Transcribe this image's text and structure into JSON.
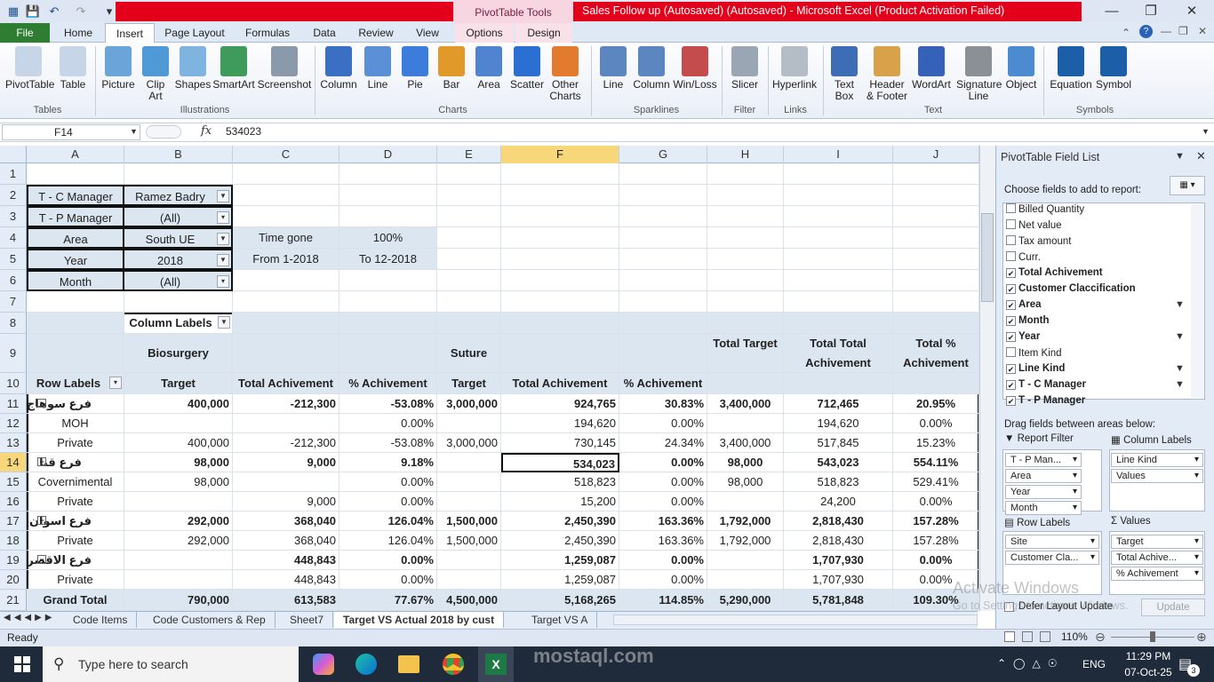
{
  "window": {
    "title": "Sales Follow up (Autosaved) (Autosaved)  -  Microsoft Excel (Product Activation Failed)",
    "context_tab": "PivotTable Tools"
  },
  "tabs": [
    "File",
    "Home",
    "Insert",
    "Page Layout",
    "Formulas",
    "Data",
    "Review",
    "View",
    "Options",
    "Design"
  ],
  "ribbon": {
    "groups": [
      "Tables",
      "Illustrations",
      "Charts",
      "Sparklines",
      "Filter",
      "Links",
      "Text",
      "Symbols"
    ],
    "buttons": [
      {
        "label": "PivotTable",
        "l2": "",
        "color": "#c7d5e8"
      },
      {
        "label": "Table",
        "l2": "",
        "color": "#c7d5e8"
      },
      {
        "label": "Picture",
        "l2": "",
        "color": "#6aa4d8"
      },
      {
        "label": "Clip",
        "l2": "Art",
        "color": "#4f9ad6"
      },
      {
        "label": "Shapes",
        "l2": "",
        "color": "#7fb3e0"
      },
      {
        "label": "SmartArt",
        "l2": "",
        "color": "#3e9b5b"
      },
      {
        "label": "Screenshot",
        "l2": "",
        "color": "#8a9aab"
      },
      {
        "label": "Column",
        "l2": "",
        "color": "#3b6fc4"
      },
      {
        "label": "Line",
        "l2": "",
        "color": "#5b8fd6"
      },
      {
        "label": "Pie",
        "l2": "",
        "color": "#3c7ddc"
      },
      {
        "label": "Bar",
        "l2": "",
        "color": "#e19a2a"
      },
      {
        "label": "Area",
        "l2": "",
        "color": "#5084d1"
      },
      {
        "label": "Scatter",
        "l2": "",
        "color": "#2a6fd1"
      },
      {
        "label": "Other",
        "l2": "Charts",
        "color": "#e37b2f"
      },
      {
        "label": "Line",
        "l2": "",
        "color": "#5b86bf"
      },
      {
        "label": "Column",
        "l2": "",
        "color": "#5b86bf"
      },
      {
        "label": "Win/Loss",
        "l2": "",
        "color": "#c44c4c"
      },
      {
        "label": "Slicer",
        "l2": "",
        "color": "#9aa6b4"
      },
      {
        "label": "Hyperlink",
        "l2": "",
        "color": "#b4bcc6"
      },
      {
        "label": "Text",
        "l2": "Box",
        "color": "#3d6db5"
      },
      {
        "label": "Header",
        "l2": "& Footer",
        "color": "#d8a24a"
      },
      {
        "label": "WordArt",
        "l2": "",
        "color": "#3561b8"
      },
      {
        "label": "Signature",
        "l2": "Line",
        "color": "#8b8f96"
      },
      {
        "label": "Object",
        "l2": "",
        "color": "#4c8bd0"
      },
      {
        "label": "Equation",
        "l2": "",
        "color": "#1d5ea8"
      },
      {
        "label": "Symbol",
        "l2": "",
        "color": "#1d5ea8"
      }
    ]
  },
  "formula": {
    "namebox": "F14",
    "fx": "fx",
    "value": "534023"
  },
  "columns": [
    "A",
    "B",
    "C",
    "D",
    "E",
    "F",
    "G",
    "H",
    "I",
    "J"
  ],
  "rows": [
    "1",
    "2",
    "3",
    "4",
    "5",
    "6",
    "7",
    "8",
    "9",
    "10",
    "11",
    "12",
    "13",
    "14",
    "15",
    "16",
    "17",
    "18",
    "19",
    "20",
    "21"
  ],
  "sheet": {
    "filters": [
      {
        "label": "T - C  Manager",
        "value": "Ramez Badry"
      },
      {
        "label": "T - P Manager",
        "value": "(All)"
      },
      {
        "label": "Area",
        "value": "South UE"
      },
      {
        "label": "Year",
        "value": "2018"
      },
      {
        "label": "Month",
        "value": "(All)"
      }
    ],
    "time": {
      "label": "Time gone",
      "value": "100%",
      "from": "From 1-2018",
      "to": "To 12-2018"
    },
    "column_labels": "Column Labels",
    "groups": {
      "bio": "Biosurgery",
      "sut": "Suture",
      "tt": "Total Target",
      "tta": "Total  Total Achivement",
      "tpa": "Total  % Achivement"
    },
    "hdr": [
      "Row Labels",
      "Target",
      "Total Achivement",
      "% Achivement",
      "Target",
      "Total Achivement",
      "% Achivement"
    ],
    "data": [
      [
        "فرع سوهاج",
        "400,000",
        "-212,300",
        "-53.08%",
        "3,000,000",
        "924,765",
        "30.83%",
        "3,400,000",
        "712,465",
        "20.95%"
      ],
      [
        "MOH",
        "",
        "",
        "0.00%",
        "",
        "194,620",
        "0.00%",
        "",
        "194,620",
        "0.00%"
      ],
      [
        "Private",
        "400,000",
        "-212,300",
        "-53.08%",
        "3,000,000",
        "730,145",
        "24.34%",
        "3,400,000",
        "517,845",
        "15.23%"
      ],
      [
        "فرع قنا",
        "98,000",
        "9,000",
        "9.18%",
        "",
        "534,023",
        "0.00%",
        "98,000",
        "543,023",
        "554.11%"
      ],
      [
        "Covernimental",
        "98,000",
        "",
        "0.00%",
        "",
        "518,823",
        "0.00%",
        "98,000",
        "518,823",
        "529.41%"
      ],
      [
        "Private",
        "",
        "9,000",
        "0.00%",
        "",
        "15,200",
        "0.00%",
        "",
        "24,200",
        "0.00%"
      ],
      [
        "فرع اسوان",
        "292,000",
        "368,040",
        "126.04%",
        "1,500,000",
        "2,450,390",
        "163.36%",
        "1,792,000",
        "2,818,430",
        "157.28%"
      ],
      [
        "Private",
        "292,000",
        "368,040",
        "126.04%",
        "1,500,000",
        "2,450,390",
        "163.36%",
        "1,792,000",
        "2,818,430",
        "157.28%"
      ],
      [
        "فرع الاقصر",
        "",
        "448,843",
        "0.00%",
        "",
        "1,259,087",
        "0.00%",
        "",
        "1,707,930",
        "0.00%"
      ],
      [
        "Private",
        "",
        "448,843",
        "0.00%",
        "",
        "1,259,087",
        "0.00%",
        "",
        "1,707,930",
        "0.00%"
      ],
      [
        "Grand Total",
        "790,000",
        "613,583",
        "77.67%",
        "4,500,000",
        "5,168,265",
        "114.85%",
        "5,290,000",
        "5,781,848",
        "109.30%"
      ]
    ]
  },
  "sheet_tabs": [
    "Code Items",
    "Code Customers & Rep",
    "Sheet7",
    "Target VS Actual 2018 by cust",
    "Target VS A"
  ],
  "status": {
    "ready": "Ready",
    "zoom": "110%"
  },
  "pane": {
    "title": "PivotTable Field List",
    "choose": "Choose fields to add to report:",
    "fields": [
      {
        "name": "Billed Quantity",
        "checked": false,
        "filter": false
      },
      {
        "name": "Net value",
        "checked": false,
        "filter": false
      },
      {
        "name": "Tax amount",
        "checked": false,
        "filter": false
      },
      {
        "name": "Curr.",
        "checked": false,
        "filter": false
      },
      {
        "name": "Total Achivement",
        "checked": true,
        "filter": false
      },
      {
        "name": "Customer Claccification",
        "checked": true,
        "filter": false
      },
      {
        "name": "Area",
        "checked": true,
        "filter": true
      },
      {
        "name": "Month",
        "checked": true,
        "filter": false
      },
      {
        "name": "Year",
        "checked": true,
        "filter": true
      },
      {
        "name": "Item Kind",
        "checked": false,
        "filter": false
      },
      {
        "name": "Line Kind",
        "checked": true,
        "filter": true
      },
      {
        "name": "T - C  Manager",
        "checked": true,
        "filter": true
      },
      {
        "name": "T - P Manager",
        "checked": true,
        "filter": false
      }
    ],
    "drag": "Drag fields between areas below:",
    "areas": {
      "report_filter": "Report Filter",
      "column_labels": "Column Labels",
      "row_labels": "Row Labels",
      "values": "Values"
    },
    "rf_items": [
      "T - P Man...",
      "Area",
      "Year",
      "Month"
    ],
    "cl_items": [
      "Line Kind",
      "Values"
    ],
    "rl_items": [
      "Site",
      "Customer Cla..."
    ],
    "v_items": [
      "Target",
      "Total Achive...",
      "% Achivement"
    ],
    "defer": "Defer Layout Update",
    "update": "Update"
  },
  "watermark": {
    "line1": "Activate Windows",
    "line2": "Go to Settings to activate Windows.",
    "site": "mostaql.com"
  },
  "taskbar": {
    "search": "Type here to search",
    "time": "11:29 PM",
    "date": "07-Oct-25",
    "lang": "ENG",
    "notif": "3"
  }
}
